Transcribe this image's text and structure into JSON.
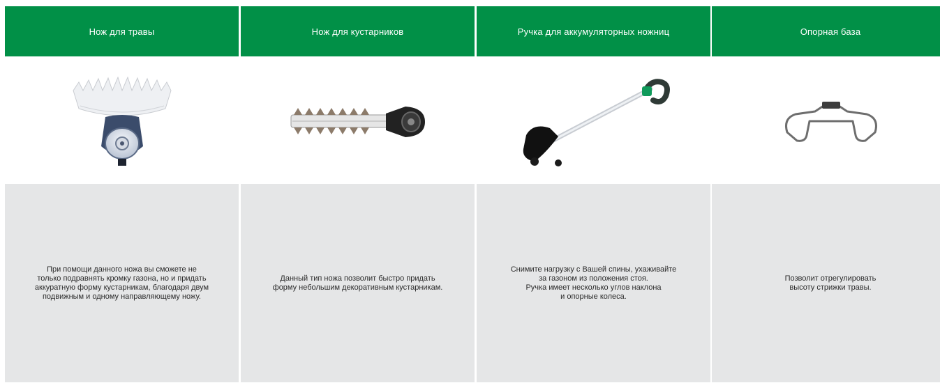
{
  "accent": "#019047",
  "panel_bg": "#e5e6e7",
  "items": [
    {
      "title": "Нож для травы",
      "image_icon": "grass-blade-icon",
      "description": "При помощи данного ножа вы сможете не\nтолько подравнять кромку газона, но и придать\nаккуратную форму кустарникам, благодаря двум\nподвижным и одному направляющему ножу."
    },
    {
      "title": "Нож для кустарников",
      "image_icon": "shrub-blade-icon",
      "description": "Данный тип ножа позволит быстро придать\nформу небольшим декоративным кустарникам."
    },
    {
      "title": "Ручка для аккумуляторных ножниц",
      "image_icon": "telescopic-handle-icon",
      "description": "Снимите нагрузку с Вашей спины, ухаживайте\nза газоном из положения стоя.\nРучка имеет несколько углов наклона\nи опорные колеса."
    },
    {
      "title": "Опорная база",
      "image_icon": "support-base-icon",
      "description": "Позволит отрегулировать\nвысоту стрижки травы."
    }
  ]
}
